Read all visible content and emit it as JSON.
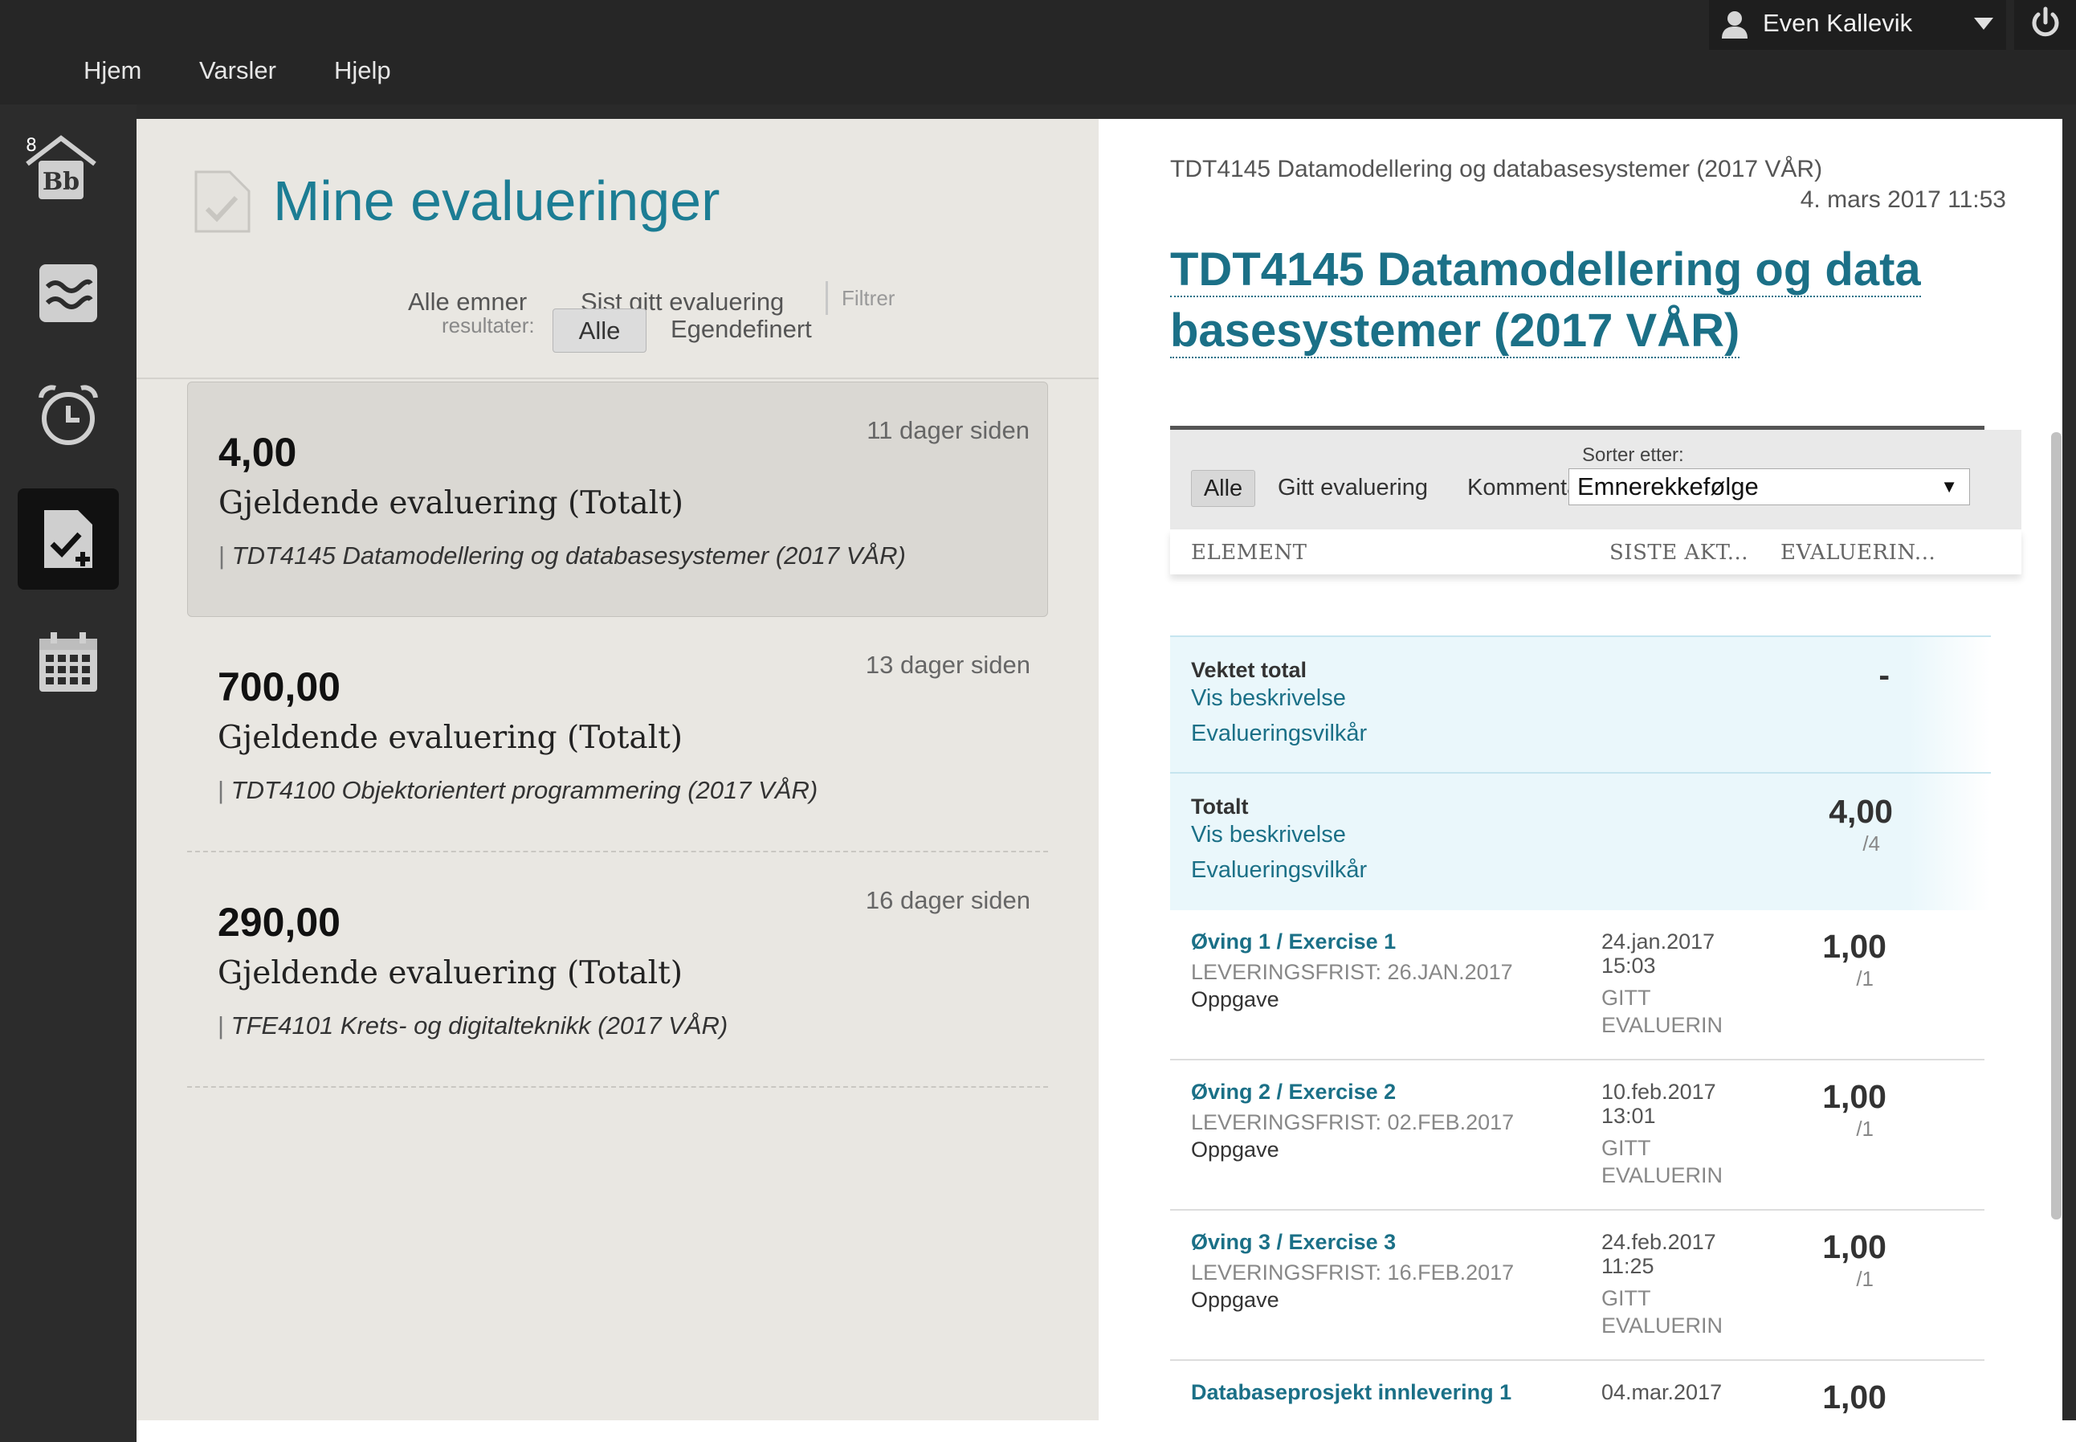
{
  "topbar": {
    "nav": [
      "Hjem",
      "Varsler",
      "Hjelp"
    ],
    "user_name": "Even Kallevik"
  },
  "rail": {
    "icons": [
      "blackboard-home-icon",
      "activity-stream-icon",
      "alarm-clock-icon",
      "grades-icon",
      "calendar-icon"
    ],
    "active": "grades-icon"
  },
  "left": {
    "title": "Mine evalueringer",
    "filter_line1_left": "Alle emner",
    "filter_line2_left": "resultater:",
    "filter_sist": "Sist gitt evaluering",
    "filter_alle": "Alle",
    "filter_egen": "Egendefinert",
    "filter_filtrer": "Filtrer",
    "cards": [
      {
        "score": "4,00",
        "label": "Gjeldende evaluering (Totalt)",
        "course": "TDT4145 Datamodellering og databasesystemer (2017 VÅR)",
        "age": "11 dager siden"
      },
      {
        "score": "700,00",
        "label": "Gjeldende evaluering (Totalt)",
        "course": "TDT4100 Objektorientert programmering (2017 VÅR)",
        "age": "13 dager siden"
      },
      {
        "score": "290,00",
        "label": "Gjeldende evaluering (Totalt)",
        "course": "TFE4101 Krets- og digitalteknikk (2017 VÅR)",
        "age": "16 dager siden"
      }
    ]
  },
  "right": {
    "course_line": "TDT4145 Datamodellering og databasesystemer (2017 VÅR)",
    "date_line": "4. mars 2017 11:53",
    "title": "TDT4145 Datamodellering og data basesystemer (2017 VÅR)",
    "sort_label": "Sorter etter:",
    "tabs": [
      "Alle",
      "Gitt evaluering",
      "Kommentarer"
    ],
    "sort_value": "Emnerekkefølge",
    "headers": [
      "ELEMENT",
      "SISTE AKT...",
      "EVALUERIN..."
    ],
    "summary": [
      {
        "label": "Vektet total",
        "link1": "Vis beskrivelse",
        "link2": "Evalueringsvilkår",
        "score": "-",
        "max": ""
      },
      {
        "label": "Totalt",
        "link1": "Vis beskrivelse",
        "link2": "Evalueringsvilkår",
        "score": "4,00",
        "max": "/4"
      }
    ],
    "items": [
      {
        "title": "Øving 1 / Exercise 1",
        "due": "LEVERINGSFRIST: 26.JAN.2017",
        "type": "Oppgave",
        "date": "24.jan.2017 15:03",
        "status": "GITT EVALUERIN",
        "score": "1,00",
        "max": "/1"
      },
      {
        "title": "Øving 2 / Exercise 2",
        "due": "LEVERINGSFRIST: 02.FEB.2017",
        "type": "Oppgave",
        "date": "10.feb.2017 13:01",
        "status": "GITT EVALUERIN",
        "score": "1,00",
        "max": "/1"
      },
      {
        "title": "Øving 3 / Exercise 3",
        "due": "LEVERINGSFRIST: 16.FEB.2017",
        "type": "Oppgave",
        "date": "24.feb.2017 11:25",
        "status": "GITT EVALUERIN",
        "score": "1,00",
        "max": "/1"
      },
      {
        "title": "Databaseprosjekt innlevering 1",
        "due": "",
        "type": "",
        "date": "04.mar.2017",
        "status": "",
        "score": "1,00",
        "max": ""
      }
    ]
  },
  "colors": {
    "accent": "#1b7087",
    "title_teal": "#1c7d94",
    "topbar": "#262626"
  }
}
